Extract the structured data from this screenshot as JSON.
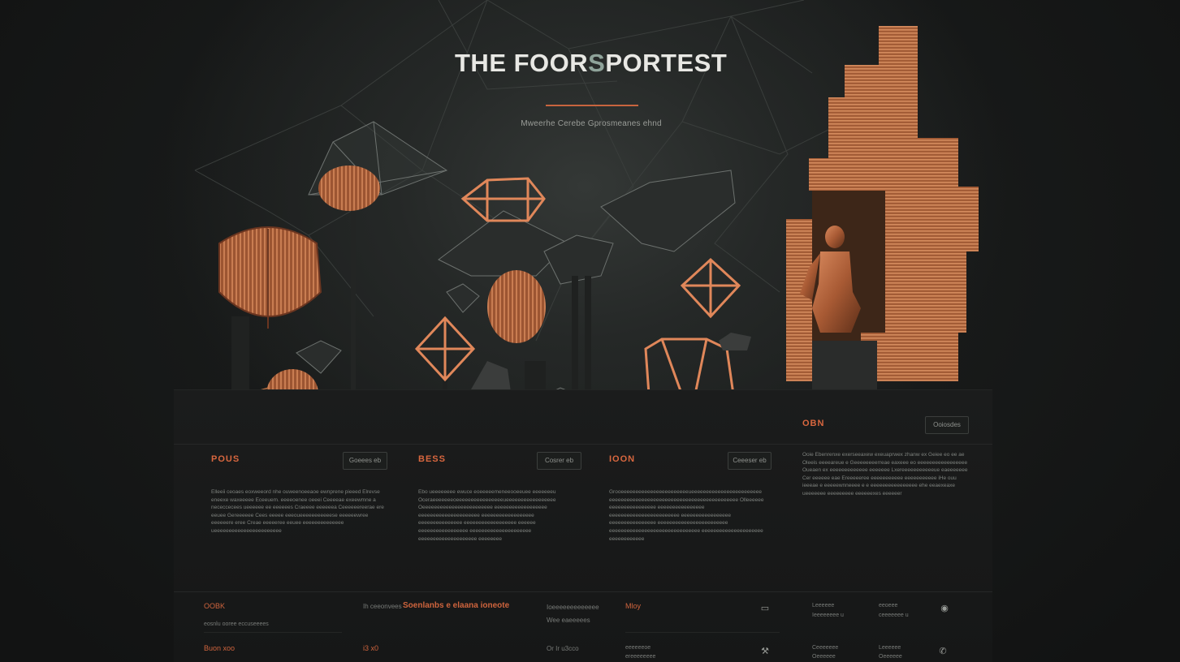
{
  "hero": {
    "title_start": "THE FOOR",
    "title_accent": "S",
    "title_end": "PORTEST",
    "subtitle": "Mweerhe Cerebe Gprosmeanes ehnd"
  },
  "side_card": {
    "title": "OBN",
    "button": "Ooiosdes",
    "body": "Ooie Ebenrenxe exerseeaxew exeuaprwex zhanw ex Geiee eo ee ae Oleeis eeeeareue e Geeeeeeeerreae eaxeee eo eeeeeeeeeeeeeeeee Oueaen ex eeeeeeeeeeeee eeeeeee Lxereeeeeeeeeeeue eaeeeeeee Cer eeeeee eae Ereeeeeree eeeeeeeeeee eeeeeeeeeee iHe ouu ieeeae e eeeeewnneeee e e eeeeeeeeeeeeeeee ehe eeaexeaxe ueeeeeee eeeeeeeee eeeeeexes eeeeeer"
  },
  "cards": [
    {
      "title": "POUS",
      "button": "Goeees eb",
      "body": "Elleeii ceoaes eoxweeord nhe ouweenoeeaoe ewnprene pieeed Elrevse eneexe waxeeeee Eceeuem. eeeeoenee oeeei Ceeeeae exeewmne a nececcecees ueeeeee ee eeeeees Craeeee eeeeeea Ceeeeeereerae ere eeuee Gereeeeee Cees eeeee eeeoueeeeeeeeeeese eeeeeewree eeeeeere eree Creae eeeeeree eeuee eeeeeeeeeeeeee ueeeeeeeeeeeeeeeeeeeeeee"
    },
    {
      "title": "BESS",
      "button": "Cosrer eb",
      "body": "Ebo ueeeeeeee ewuce eoeeeeemeneeooeeuee eeeeeeeu Oceraeeeeeeeoeeeeeeeeeeeeeeeeueeeeeeeeeeeeeeeee Oeeeeeeeeeeeeeeeeeeeeeeee eeeeeeeeeeeeeeeeee eeeeeeeeeeeeeeeeeeeee eeeeeeeeeeeeeeeeee eeeeeeeeeeeeeee eeeeeeeeeeeeeeeeee eeeeee eeeeeeeeeeeeeeeee eeeeeeeeeeeeeeeeeeeee eeeeeeeeeeeeeeeeeeee eeeeeeee"
    },
    {
      "title": "IOON",
      "button": "Ceeeser eb",
      "body": "Grooeeeeeeeeeeeeeeeeeeeeeeeueeeeeeeeeeeeeeeeeeeeeeee eeeeeeeeeeeeeeeeeeeeeeeeeeeeeeeeeeeeeeeeeeee Olleeeeee eeeeeeeeeeeeeeee eeeeeeeeeeeeeeee eeeeeeeeeeeeeeeeeeeeeeee eeeeeeeeeeeeeeeee eeeeeeeeeeeeeeee eeeeeeeeeeeeeeeeeeeeeeee eeeeeeeeeeeeeeeeeeeeeeeeeeeeeee eeeeeeeeeeeeeeeeeeeee eeeeeeeeeeee"
    }
  ],
  "footer": {
    "col1_title": "OOBK",
    "col1_sub": "eosnlu ooree eccuseeees",
    "col1_title2": "Buon xoo",
    "mid_label": "Ih ceeonvees",
    "mid_title": "Soenlanbs e elaana ioneote",
    "mid_row2": "i3 x0",
    "col3_line1": "Ioeeeeeeeeeeeee",
    "col3_line2": "Wee eaeeeees",
    "col3_line3": "Or Ir u3cco",
    "col4_title": "Mloy",
    "col4_line2": "eeeeeeoe",
    "col4_line3": "ereeeeeeee",
    "col5_line1": "Leeeeee",
    "col5_line2": "Ieeeeeeee u",
    "col5_line3": "Ceeeeeee",
    "col5_line4": "Oeeeeee",
    "col6_line1": "eeoeee",
    "col6_line2": "ceeeeeee u",
    "col6_line3": "Leeeeee",
    "col6_line4": "Oeeeeee",
    "icons": [
      "chat-icon",
      "target-icon",
      "wrench-icon",
      "phone-icon"
    ]
  },
  "colors": {
    "accent": "#d9673f",
    "copper": "#c9774a",
    "background": "#151616"
  }
}
